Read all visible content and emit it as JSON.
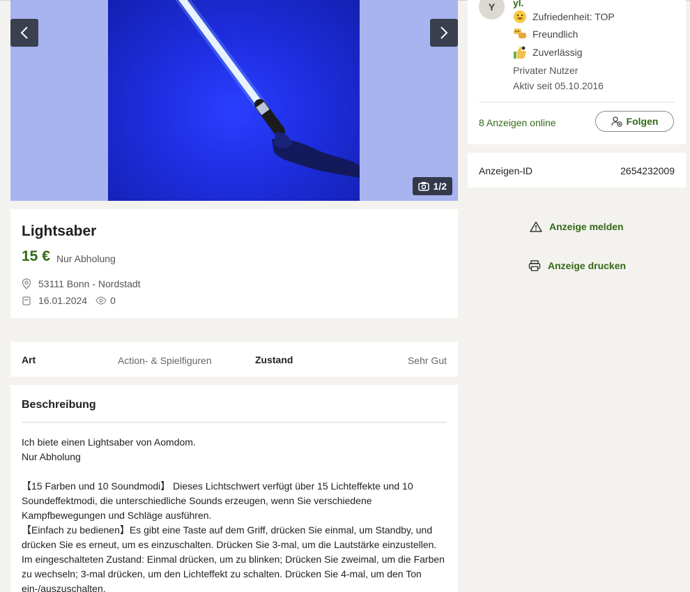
{
  "gallery": {
    "counter": "1/2",
    "icons": {
      "prev": "chevron-left-icon",
      "next": "chevron-right-icon",
      "counter": "camera-icon"
    }
  },
  "ad": {
    "title": "Lightsaber",
    "price": "15 €",
    "price_note": "Nur Abholung",
    "location": "53111 Bonn - Nordstadt",
    "date": "16.01.2024",
    "views": "0"
  },
  "details": {
    "art_label": "Art",
    "art_value": "Action- & Spielfiguren",
    "zustand_label": "Zustand",
    "zustand_value": "Sehr Gut"
  },
  "description": {
    "heading": "Beschreibung",
    "paragraphs": [
      "Ich biete einen Lightsaber von Aomdom.",
      "Nur Abholung",
      "",
      "【15 Farben und 10 Soundmodi】 Dieses Lichtschwert verfügt über 15 Lichteffekte und 10 Soundeffektmodi, die unterschiedliche Sounds erzeugen, wenn Sie verschiedene Kampfbewegungen und Schläge ausführen.",
      "【Einfach zu bedienen】Es gibt eine Taste auf dem Griff, drücken Sie einmal, um Standby, und drücken Sie es erneut, um es einzuschalten. Drücken Sie 3-mal, um die Lautstärke einzustellen. Im eingeschalteten Zustand: Einmal drücken, um zu blinken; Drücken Sie zweimal, um die Farben zu wechseln; 3-mal drücken, um den Lichteffekt zu schalten. Drücken Sie 4-mal, um den Ton ein-/auszuschalten."
    ]
  },
  "seller": {
    "avatar_letter": "Y",
    "name": "yl.",
    "badges": [
      {
        "label": "Zufriedenheit: TOP",
        "icon": "smiley-icon"
      },
      {
        "label": "Freundlich",
        "icon": "chat-bubbles-icon"
      },
      {
        "label": "Zuverlässig",
        "icon": "thumbs-up-icon"
      }
    ],
    "type": "Privater Nutzer",
    "active_since": "Aktiv seit 05.10.2016",
    "ads_online": "8 Anzeigen online",
    "follow_label": "Folgen"
  },
  "ad_id": {
    "label": "Anzeigen-ID",
    "value": "2654232009"
  },
  "actions": {
    "report": "Anzeige melden",
    "print": "Anzeige drucken"
  },
  "colors": {
    "accent_green": "#326916",
    "page_bg": "#f4f2ef"
  }
}
